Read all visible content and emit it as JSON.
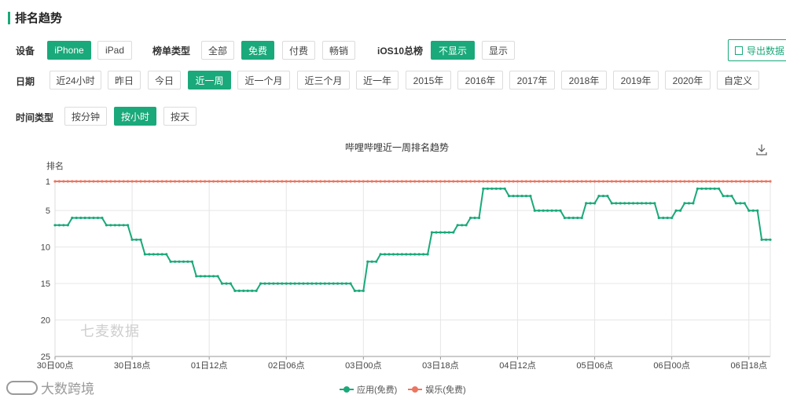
{
  "section_title": "排名趋势",
  "filters": {
    "device": {
      "label": "设备",
      "options": [
        "iPhone",
        "iPad"
      ],
      "selected": "iPhone"
    },
    "list_type": {
      "label": "榜单类型",
      "options": [
        "全部",
        "免费",
        "付费",
        "畅销"
      ],
      "selected": "免费"
    },
    "ios10": {
      "label": "iOS10总榜",
      "options": [
        "不显示",
        "显示"
      ],
      "selected": "不显示"
    },
    "date": {
      "label": "日期",
      "options": [
        "近24小时",
        "昨日",
        "今日",
        "近一周",
        "近一个月",
        "近三个月",
        "近一年",
        "2015年",
        "2016年",
        "2017年",
        "2018年",
        "2019年",
        "2020年",
        "自定义"
      ],
      "selected": "近一周"
    },
    "time_type": {
      "label": "时间类型",
      "options": [
        "按分钟",
        "按小时",
        "按天"
      ],
      "selected": "按小时"
    }
  },
  "export_label": "导出数据",
  "watermarks": {
    "chart": "七麦数据",
    "corner": "大数跨境"
  },
  "chart_data": {
    "type": "line",
    "title": "哔哩哔哩近一周排名趋势",
    "ylabel": "排名",
    "y_inverted": true,
    "ylim": [
      1,
      25
    ],
    "yticks": [
      1,
      5,
      10,
      15,
      20,
      25
    ],
    "x_tick_labels": [
      "30日00点",
      "30日18点",
      "01日12点",
      "02日06点",
      "03日00点",
      "03日18点",
      "04日12点",
      "05日06点",
      "06日00点",
      "06日18点"
    ],
    "x_tick_hours": [
      0,
      18,
      36,
      54,
      72,
      90,
      108,
      126,
      144,
      162
    ],
    "x_range_hours": [
      0,
      167
    ],
    "grid": true,
    "legend_position": "bottom",
    "series": [
      {
        "name": "应用(免费)",
        "color": "#1aa97a",
        "segments": [
          {
            "from": 0,
            "to": 3,
            "rank": 7
          },
          {
            "from": 4,
            "to": 11,
            "rank": 6
          },
          {
            "from": 12,
            "to": 17,
            "rank": 7
          },
          {
            "from": 18,
            "to": 20,
            "rank": 9
          },
          {
            "from": 21,
            "to": 26,
            "rank": 11
          },
          {
            "from": 27,
            "to": 32,
            "rank": 12
          },
          {
            "from": 33,
            "to": 38,
            "rank": 14
          },
          {
            "from": 39,
            "to": 41,
            "rank": 15
          },
          {
            "from": 42,
            "to": 47,
            "rank": 16
          },
          {
            "from": 48,
            "to": 69,
            "rank": 15
          },
          {
            "from": 70,
            "to": 72,
            "rank": 16
          },
          {
            "from": 73,
            "to": 75,
            "rank": 12
          },
          {
            "from": 76,
            "to": 87,
            "rank": 11
          },
          {
            "from": 88,
            "to": 93,
            "rank": 8
          },
          {
            "from": 94,
            "to": 96,
            "rank": 7
          },
          {
            "from": 97,
            "to": 99,
            "rank": 6
          },
          {
            "from": 100,
            "to": 105,
            "rank": 2
          },
          {
            "from": 106,
            "to": 111,
            "rank": 3
          },
          {
            "from": 112,
            "to": 118,
            "rank": 5
          },
          {
            "from": 119,
            "to": 123,
            "rank": 6
          },
          {
            "from": 124,
            "to": 126,
            "rank": 4
          },
          {
            "from": 127,
            "to": 129,
            "rank": 3
          },
          {
            "from": 130,
            "to": 140,
            "rank": 4
          },
          {
            "from": 141,
            "to": 144,
            "rank": 6
          },
          {
            "from": 145,
            "to": 146,
            "rank": 5
          },
          {
            "from": 147,
            "to": 149,
            "rank": 4
          },
          {
            "from": 150,
            "to": 155,
            "rank": 2
          },
          {
            "from": 156,
            "to": 158,
            "rank": 3
          },
          {
            "from": 159,
            "to": 161,
            "rank": 4
          },
          {
            "from": 162,
            "to": 164,
            "rank": 5
          },
          {
            "from": 165,
            "to": 167,
            "rank": 9
          }
        ]
      },
      {
        "name": "娱乐(免费)",
        "color": "#ec7660",
        "segments": [
          {
            "from": 0,
            "to": 167,
            "rank": 1
          }
        ]
      }
    ]
  }
}
